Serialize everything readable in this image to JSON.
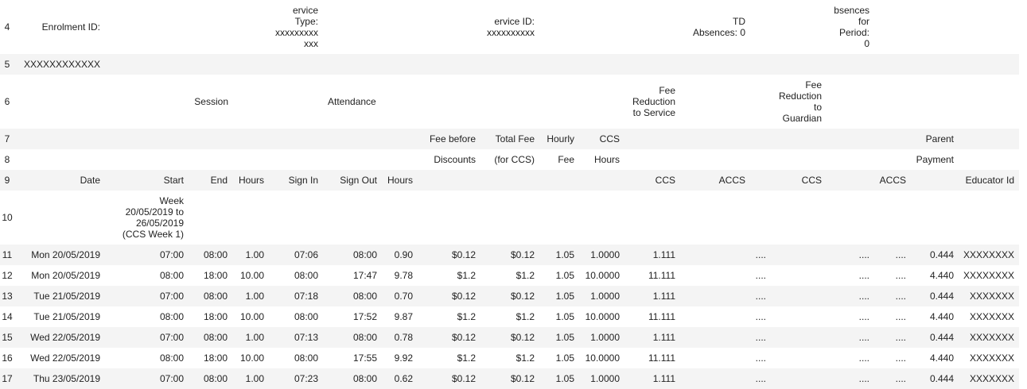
{
  "rows": {
    "r4": {
      "num": "4",
      "enrolment_label": "Enrolment ID:",
      "service_type": "ervice\nType:\nxxxxxxxxx\nxxx",
      "service_id": "ervice ID:\nxxxxxxxxxx",
      "td_absences": "TD\nAbsences: 0",
      "absences_period": "bsences\nfor\nPeriod:\n0"
    },
    "r5": {
      "num": "5",
      "child_name": "XXXXXXXXXXXX"
    },
    "r6": {
      "num": "6",
      "session": "Session",
      "attendance": "Attendance",
      "fee_reduction_service": "Fee\nReduction\nto Service",
      "fee_reduction_guardian": "Fee\nReduction\nto\nGuardian"
    },
    "r7": {
      "num": "7",
      "fee_before": "Fee before",
      "total_fee": "Total Fee",
      "hourly": "Hourly",
      "ccs": "CCS",
      "parent": "Parent"
    },
    "r8": {
      "num": "8",
      "discounts": "Discounts",
      "for_ccs": "(for CCS)",
      "fee": "Fee",
      "hours": "Hours",
      "payment": "Payment"
    },
    "r9": {
      "num": "9",
      "date": "Date",
      "start": "Start",
      "end": "End",
      "hours": "Hours",
      "sign_in": "Sign In",
      "sign_out": "Sign Out",
      "att_hours": "Hours",
      "ccs_service": "CCS",
      "accs_service": "ACCS",
      "ccs_guardian": "CCS",
      "accs_guardian": "ACCS",
      "educator_id": "Educator Id"
    },
    "r10": {
      "num": "10",
      "week": "Week\n20/05/2019 to\n26/05/2019\n(CCS Week 1)"
    }
  },
  "attendance_rows": [
    {
      "num": "11",
      "date": "Mon 20/05/2019",
      "start": "07:00",
      "end": "08:00",
      "hours": "1.00",
      "sign_in": "07:06",
      "sign_out": "08:00",
      "att_hours": "0.90",
      "fee_before": "$0.12",
      "total_fee": "$0.12",
      "hourly": "1.05",
      "ccs_hours": "1.0000",
      "ccs": "1.111",
      "accs": "....",
      "ccs_g": "....",
      "accs_g": "....",
      "parent_payment": "0.444",
      "educator": "XXXXXXXX"
    },
    {
      "num": "12",
      "date": "Mon 20/05/2019",
      "start": "08:00",
      "end": "18:00",
      "hours": "10.00",
      "sign_in": "08:00",
      "sign_out": "17:47",
      "att_hours": "9.78",
      "fee_before": "$1.2",
      "total_fee": "$1.2",
      "hourly": "1.05",
      "ccs_hours": "10.0000",
      "ccs": "11.111",
      "accs": "....",
      "ccs_g": "....",
      "accs_g": "....",
      "parent_payment": "4.440",
      "educator": "XXXXXXXX"
    },
    {
      "num": "13",
      "date": "Tue 21/05/2019",
      "start": "07:00",
      "end": "08:00",
      "hours": "1.00",
      "sign_in": "07:18",
      "sign_out": "08:00",
      "att_hours": "0.70",
      "fee_before": "$0.12",
      "total_fee": "$0.12",
      "hourly": "1.05",
      "ccs_hours": "1.0000",
      "ccs": "1.111",
      "accs": "....",
      "ccs_g": "....",
      "accs_g": "....",
      "parent_payment": "0.444",
      "educator": "XXXXXXX"
    },
    {
      "num": "14",
      "date": "Tue 21/05/2019",
      "start": "08:00",
      "end": "18:00",
      "hours": "10.00",
      "sign_in": "08:00",
      "sign_out": "17:52",
      "att_hours": "9.87",
      "fee_before": "$1.2",
      "total_fee": "$1.2",
      "hourly": "1.05",
      "ccs_hours": "10.0000",
      "ccs": "11.111",
      "accs": "....",
      "ccs_g": "....",
      "accs_g": "....",
      "parent_payment": "4.440",
      "educator": "XXXXXXX"
    },
    {
      "num": "15",
      "date": "Wed 22/05/2019",
      "start": "07:00",
      "end": "08:00",
      "hours": "1.00",
      "sign_in": "07:13",
      "sign_out": "08:00",
      "att_hours": "0.78",
      "fee_before": "$0.12",
      "total_fee": "$0.12",
      "hourly": "1.05",
      "ccs_hours": "1.0000",
      "ccs": "1.111",
      "accs": "....",
      "ccs_g": "....",
      "accs_g": "....",
      "parent_payment": "0.444",
      "educator": "XXXXXXX"
    },
    {
      "num": "16",
      "date": "Wed 22/05/2019",
      "start": "08:00",
      "end": "18:00",
      "hours": "10.00",
      "sign_in": "08:00",
      "sign_out": "17:55",
      "att_hours": "9.92",
      "fee_before": "$1.2",
      "total_fee": "$1.2",
      "hourly": "1.05",
      "ccs_hours": "10.0000",
      "ccs": "11.111",
      "accs": "....",
      "ccs_g": "....",
      "accs_g": "....",
      "parent_payment": "4.440",
      "educator": "XXXXXXX"
    },
    {
      "num": "17",
      "date": "Thu 23/05/2019",
      "start": "07:00",
      "end": "08:00",
      "hours": "1.00",
      "sign_in": "07:23",
      "sign_out": "08:00",
      "att_hours": "0.62",
      "fee_before": "$0.12",
      "total_fee": "$0.12",
      "hourly": "1.05",
      "ccs_hours": "1.0000",
      "ccs": "1.111",
      "accs": "....",
      "ccs_g": "....",
      "accs_g": "....",
      "parent_payment": "0.444",
      "educator": "XXXXXXX"
    }
  ]
}
